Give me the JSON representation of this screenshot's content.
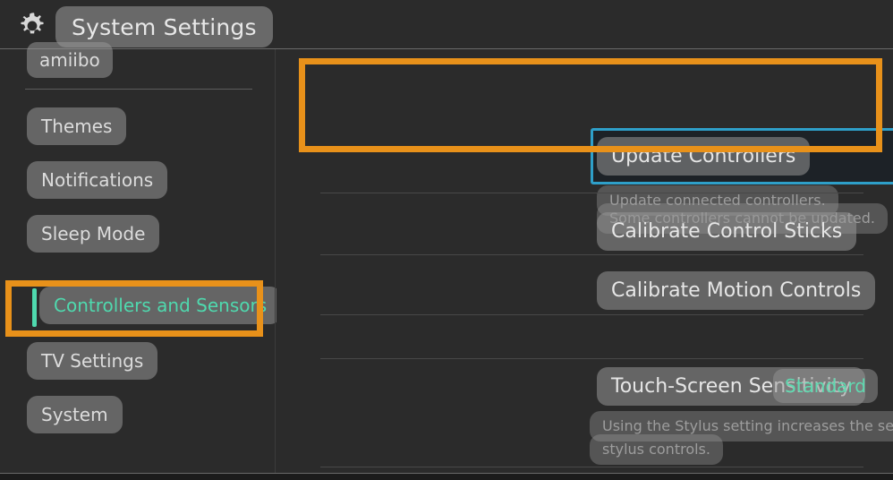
{
  "header": {
    "icon": "gear-icon",
    "title": "System Settings"
  },
  "sidebar": {
    "top_item": {
      "label": "amiibo"
    },
    "items": [
      {
        "label": "Themes",
        "selected": false
      },
      {
        "label": "Notifications",
        "selected": false
      },
      {
        "label": "Sleep Mode",
        "selected": false
      },
      {
        "label": "Controllers and Sensors",
        "selected": true
      },
      {
        "label": "TV Settings",
        "selected": false
      },
      {
        "label": "System",
        "selected": false
      }
    ]
  },
  "main": {
    "rows": [
      {
        "label": "Update Controllers",
        "description_line1": "Update connected controllers.",
        "description_line2": "Some controllers cannot be updated.",
        "focused": true
      },
      {
        "label": "Calibrate Control Sticks"
      },
      {
        "label": "Calibrate Motion Controls"
      },
      {
        "label": "Touch-Screen Sensitivity",
        "value": "Standard",
        "description_line1": "Using the Stylus setting increases the sensitivity of the touch screen to enhance",
        "description_line2": "stylus controls."
      }
    ]
  },
  "annotations": {
    "main_box": "update-controllers-highlight",
    "sidebar_box": "controllers-and-sensors-highlight",
    "box_color": "#e8911a",
    "focus_color": "#2e9fc9",
    "accent_color": "#4fd9ae"
  }
}
